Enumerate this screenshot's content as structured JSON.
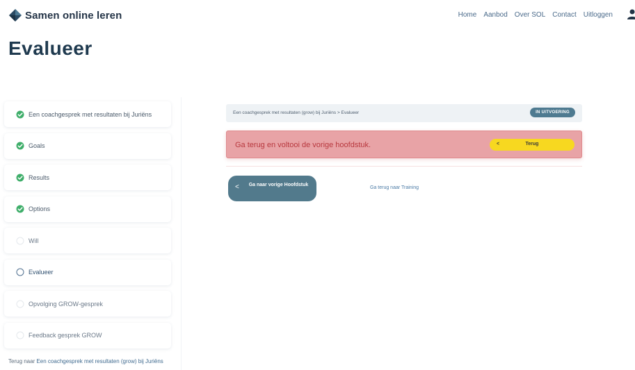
{
  "header": {
    "logo_text": "Samen online leren",
    "nav": [
      "Home",
      "Aanbod",
      "Over SOL",
      "Contact",
      "Uitloggen"
    ]
  },
  "page": {
    "title": "Evalueer"
  },
  "sidebar": {
    "chapters": [
      {
        "label": "Een coachgesprek met resultaten bij Juriëns",
        "state": "completed"
      },
      {
        "label": "Goals",
        "state": "completed"
      },
      {
        "label": "Results",
        "state": "completed"
      },
      {
        "label": "Options",
        "state": "completed"
      },
      {
        "label": "Will",
        "state": "locked"
      },
      {
        "label": "Evalueer",
        "state": "current"
      },
      {
        "label": "Opvolging GROW-gesprek",
        "state": "locked"
      },
      {
        "label": "Feedback gesprek GROW",
        "state": "locked"
      }
    ],
    "back_prefix": "Terug naar ",
    "back_link": "Een coachgesprek met resultaten (grow) bij Juriëns"
  },
  "content": {
    "breadcrumb": "Een coachgesprek met resultaten (grow) bij Juriëns > Evalueer",
    "status": "IN UITVOERING",
    "alert_text": "Ga terug en voltooi de vorige hoofdstuk.",
    "terug_chevron": "<",
    "terug_label": "Terug",
    "prev_chevron": "<",
    "prev_label": "Ga naar vorige Hoofdstuk",
    "training_link": "Ga terug naar Training"
  },
  "colors": {
    "completed": "#3fae6a",
    "current": "#4f6f8f",
    "locked": "#e4e8ec"
  }
}
